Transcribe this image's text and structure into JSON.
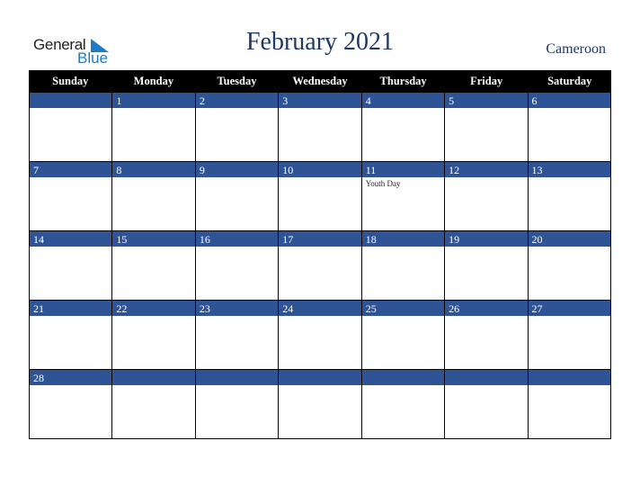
{
  "logo": {
    "line1": "General",
    "line2": "Blue"
  },
  "header": {
    "title": "February 2021",
    "country": "Cameroon"
  },
  "colors": {
    "title": "#1f3864",
    "day_bar": "#2e5496",
    "header_bar": "#000000",
    "logo_blue": "#1f7bc4"
  },
  "weekdays": [
    "Sunday",
    "Monday",
    "Tuesday",
    "Wednesday",
    "Thursday",
    "Friday",
    "Saturday"
  ],
  "weeks": [
    [
      {
        "day": "",
        "event": ""
      },
      {
        "day": "1",
        "event": ""
      },
      {
        "day": "2",
        "event": ""
      },
      {
        "day": "3",
        "event": ""
      },
      {
        "day": "4",
        "event": ""
      },
      {
        "day": "5",
        "event": ""
      },
      {
        "day": "6",
        "event": ""
      }
    ],
    [
      {
        "day": "7",
        "event": ""
      },
      {
        "day": "8",
        "event": ""
      },
      {
        "day": "9",
        "event": ""
      },
      {
        "day": "10",
        "event": ""
      },
      {
        "day": "11",
        "event": "Youth Day"
      },
      {
        "day": "12",
        "event": ""
      },
      {
        "day": "13",
        "event": ""
      }
    ],
    [
      {
        "day": "14",
        "event": ""
      },
      {
        "day": "15",
        "event": ""
      },
      {
        "day": "16",
        "event": ""
      },
      {
        "day": "17",
        "event": ""
      },
      {
        "day": "18",
        "event": ""
      },
      {
        "day": "19",
        "event": ""
      },
      {
        "day": "20",
        "event": ""
      }
    ],
    [
      {
        "day": "21",
        "event": ""
      },
      {
        "day": "22",
        "event": ""
      },
      {
        "day": "23",
        "event": ""
      },
      {
        "day": "24",
        "event": ""
      },
      {
        "day": "25",
        "event": ""
      },
      {
        "day": "26",
        "event": ""
      },
      {
        "day": "27",
        "event": ""
      }
    ],
    [
      {
        "day": "28",
        "event": ""
      },
      {
        "day": "",
        "event": ""
      },
      {
        "day": "",
        "event": ""
      },
      {
        "day": "",
        "event": ""
      },
      {
        "day": "",
        "event": ""
      },
      {
        "day": "",
        "event": ""
      },
      {
        "day": "",
        "event": ""
      }
    ]
  ]
}
